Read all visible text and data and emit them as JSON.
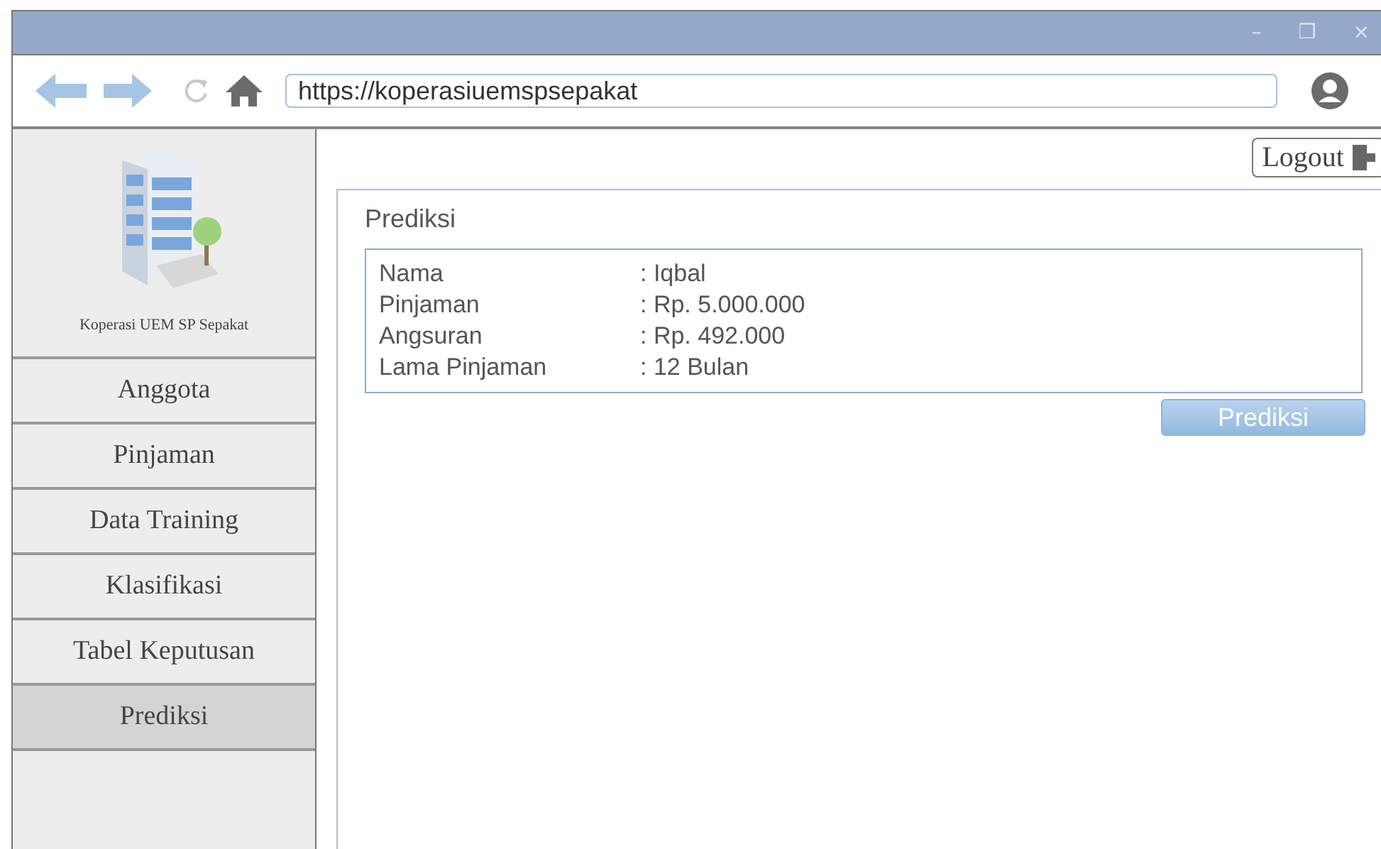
{
  "window": {
    "controls": [
      "–",
      "❐",
      "×"
    ]
  },
  "toolbar": {
    "url": "https://koperasiuemspsepakat"
  },
  "sidebar": {
    "brand": "Koperasi UEM SP Sepakat",
    "items": [
      {
        "label": "Anggota",
        "selected": false
      },
      {
        "label": "Pinjaman",
        "selected": false
      },
      {
        "label": "Data Training",
        "selected": false
      },
      {
        "label": "Klasifikasi",
        "selected": false
      },
      {
        "label": "Tabel Keputusan",
        "selected": false
      },
      {
        "label": "Prediksi",
        "selected": true
      }
    ]
  },
  "logout": {
    "label": "Logout"
  },
  "panel": {
    "title": "Prediksi",
    "fields": [
      {
        "label": "Nama",
        "value": ": Iqbal"
      },
      {
        "label": "Pinjaman",
        "value": ": Rp. 5.000.000"
      },
      {
        "label": "Angsuran",
        "value": ": Rp. 492.000"
      },
      {
        "label": "Lama Pinjaman",
        "value": ": 12 Bulan"
      }
    ],
    "button": "Prediksi"
  }
}
